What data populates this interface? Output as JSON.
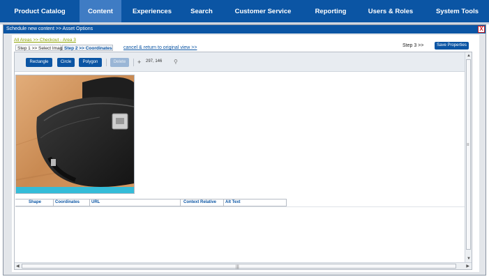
{
  "nav": {
    "items": [
      {
        "label": "Product Catalog"
      },
      {
        "label": "Content",
        "active": true
      },
      {
        "label": "Experiences"
      },
      {
        "label": "Search"
      },
      {
        "label": "Customer Service"
      },
      {
        "label": "Reporting"
      },
      {
        "label": "Users & Roles"
      },
      {
        "label": "System Tools"
      }
    ]
  },
  "dialog": {
    "title": "Schedule new content >> Asset Options",
    "close_glyph": "X",
    "breadcrumb": "All Areas >> Checkout - Area 3",
    "step1": "Step 1 >> Select Image",
    "step2": "Step 2 >> Coordinates",
    "cancel_link": "cancel & return to original view >>",
    "step3": "Step 3 >>",
    "save_button": "Save Properties"
  },
  "toolbar": {
    "rectangle": "Rectangle",
    "circle": "Circle",
    "polygon": "Polygon",
    "delete": "Delete",
    "cross_glyph": "+",
    "coordinates": "297, 146",
    "person_glyph": "⚲"
  },
  "table": {
    "headers": [
      "Shape",
      "Coordinates",
      "URL",
      "Context Relative",
      "Alt Text"
    ]
  },
  "scroll": {
    "up": "▲",
    "down": "▼",
    "left": "◀",
    "right": "▶",
    "grip_v": "≡",
    "grip_h": "|||"
  },
  "colors": {
    "brand": "#0b55a4",
    "nav_active": "#3f7cc4",
    "crumb": "#8aa100"
  },
  "icons": [
    "close-icon",
    "crosshair-icon",
    "pin-icon",
    "scroll-arrow-icon"
  ]
}
